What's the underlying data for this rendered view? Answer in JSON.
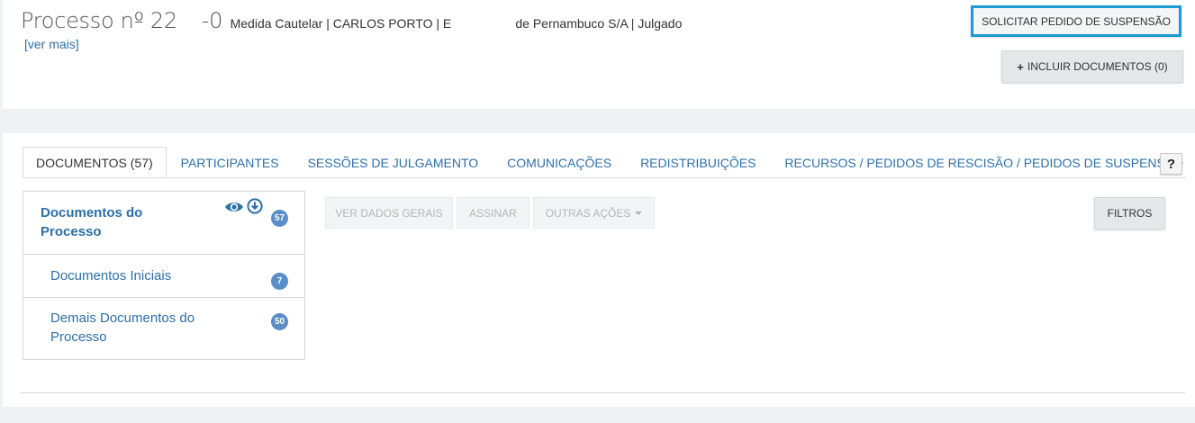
{
  "header": {
    "process_label": "Processo nº 22      -0",
    "meta": "Medida Cautelar | CARLOS PORTO | E                         de Pernambuco S/A | Julgado",
    "ver_mais": "[ver mais]",
    "solicitar_label": "SOLICITAR PEDIDO DE SUSPENSÃO",
    "incluir_label": "INCLUIR DOCUMENTOS (0)"
  },
  "tabs": [
    {
      "label": "DOCUMENTOS (57)",
      "active": true
    },
    {
      "label": "PARTICIPANTES"
    },
    {
      "label": "SESSÕES DE JULGAMENTO"
    },
    {
      "label": "COMUNICAÇÕES"
    },
    {
      "label": "REDISTRIBUIÇÕES"
    },
    {
      "label": "RECURSOS / PEDIDOS DE RESCISÃO / PEDIDOS DE SUSPENSÃO"
    }
  ],
  "help": "?",
  "tree": {
    "root": {
      "label": "Documentos do Processo",
      "count": "57"
    },
    "items": [
      {
        "label": "Documentos Iniciais",
        "count": "7"
      },
      {
        "label": "Demais Documentos do Processo",
        "count": "50"
      }
    ]
  },
  "actions": {
    "ver_dados": "VER DADOS GERAIS",
    "assinar": "ASSINAR",
    "outras": "OUTRAS AÇÕES",
    "filtros": "FILTROS"
  },
  "colors": {
    "accent": "#1b9ad3",
    "link": "#2d6fa8",
    "badge": "#5b8ec9"
  }
}
